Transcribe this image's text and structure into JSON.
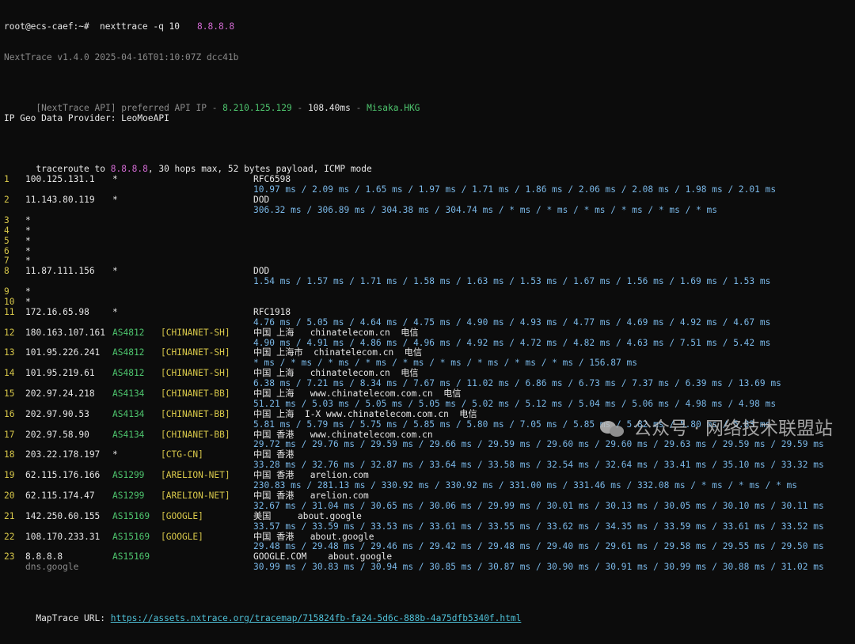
{
  "header": {
    "prompt": "root@ecs-caef:~#",
    "command": "nexttrace -q 10",
    "target": "8.8.8.8",
    "version_line": "NextTrace v1.4.0 2025-04-16T01:10:07Z dcc41b",
    "api_prefix": "[NextTrace API] preferred API IP - ",
    "api_ip": "8.210.125.129",
    "api_dash": " - ",
    "api_latency": "108.40ms",
    "api_dash2": " - ",
    "api_node": "Misaka.HKG",
    "geo_provider": "IP Geo Data Provider: LeoMoeAPI",
    "trace_prefix": "traceroute to ",
    "trace_target": "8.8.8.8",
    "trace_suffix": ", 30 hops max, 52 bytes payload, ICMP mode"
  },
  "hops": [
    {
      "n": "1",
      "ip": "100.125.131.1",
      "asn": "*",
      "tag": "",
      "geo": "RFC6598",
      "rtt": "10.97 ms / 2.09 ms / 1.65 ms / 1.97 ms / 1.71 ms / 1.86 ms / 2.06 ms / 2.08 ms / 1.98 ms / 2.01 ms"
    },
    {
      "n": "2",
      "ip": "11.143.80.119",
      "asn": "*",
      "tag": "",
      "geo": "DOD",
      "rtt": "306.32 ms / 306.89 ms / 304.38 ms / 304.74 ms / * ms / * ms / * ms / * ms / * ms / * ms"
    },
    {
      "n": "3",
      "ip": "*",
      "star": true
    },
    {
      "n": "4",
      "ip": "*",
      "star": true
    },
    {
      "n": "5",
      "ip": "*",
      "star": true
    },
    {
      "n": "6",
      "ip": "*",
      "star": true
    },
    {
      "n": "7",
      "ip": "*",
      "star": true
    },
    {
      "n": "8",
      "ip": "11.87.111.156",
      "asn": "*",
      "tag": "",
      "geo": "DOD",
      "rtt": "1.54 ms / 1.57 ms / 1.71 ms / 1.58 ms / 1.63 ms / 1.53 ms / 1.67 ms / 1.56 ms / 1.69 ms / 1.53 ms"
    },
    {
      "n": "9",
      "ip": "*",
      "star": true
    },
    {
      "n": "10",
      "ip": "*",
      "star": true
    },
    {
      "n": "11",
      "ip": "172.16.65.98",
      "asn": "*",
      "tag": "",
      "geo": "RFC1918",
      "rtt": "4.76 ms / 5.05 ms / 4.64 ms / 4.75 ms / 4.90 ms / 4.93 ms / 4.77 ms / 4.69 ms / 4.92 ms / 4.67 ms"
    },
    {
      "n": "12",
      "ip": "180.163.107.161",
      "asn": "AS4812",
      "tag": "[CHINANET-SH]",
      "geo": "中国 上海   chinatelecom.cn  电信",
      "rtt": "4.90 ms / 4.91 ms / 4.86 ms / 4.96 ms / 4.92 ms / 4.72 ms / 4.82 ms / 4.63 ms / 7.51 ms / 5.42 ms"
    },
    {
      "n": "13",
      "ip": "101.95.226.241",
      "asn": "AS4812",
      "tag": "[CHINANET-SH]",
      "geo": "中国 上海市  chinatelecom.cn  电信",
      "rtt": "* ms / * ms / * ms / * ms / * ms / * ms / * ms / * ms / * ms / 156.87 ms"
    },
    {
      "n": "14",
      "ip": "101.95.219.61",
      "asn": "AS4812",
      "tag": "[CHINANET-SH]",
      "geo": "中国 上海   chinatelecom.cn  电信",
      "rtt": "6.38 ms / 7.21 ms / 8.34 ms / 7.67 ms / 11.02 ms / 6.86 ms / 6.73 ms / 7.37 ms / 6.39 ms / 13.69 ms"
    },
    {
      "n": "15",
      "ip": "202.97.24.218",
      "asn": "AS4134",
      "tag": "[CHINANET-BB]",
      "geo": "中国 上海   www.chinatelecom.com.cn  电信",
      "rtt": "51.21 ms / 5.03 ms / 5.05 ms / 5.05 ms / 5.02 ms / 5.12 ms / 5.04 ms / 5.06 ms / 4.98 ms / 4.98 ms"
    },
    {
      "n": "16",
      "ip": "202.97.90.53",
      "asn": "AS4134",
      "tag": "[CHINANET-BB]",
      "geo": "中国 上海  I-X www.chinatelecom.com.cn  电信",
      "rtt": "5.81 ms / 5.79 ms / 5.75 ms / 5.85 ms / 5.80 ms / 7.05 ms / 5.85 ms / 5.82 ms / 5.80 ms / 5.83 ms"
    },
    {
      "n": "17",
      "ip": "202.97.58.90",
      "asn": "AS4134",
      "tag": "[CHINANET-BB]",
      "geo": "中国 香港   www.chinatelecom.com.cn",
      "rtt": "29.72 ms / 29.76 ms / 29.59 ms / 29.66 ms / 29.59 ms / 29.60 ms / 29.60 ms / 29.63 ms / 29.59 ms / 29.59 ms"
    },
    {
      "n": "18",
      "ip": "203.22.178.197",
      "asn": "*",
      "tag": "[CTG-CN]",
      "geo": "中国 香港",
      "rtt": "33.28 ms / 32.76 ms / 32.87 ms / 33.64 ms / 33.58 ms / 32.54 ms / 32.64 ms / 33.41 ms / 35.10 ms / 33.32 ms"
    },
    {
      "n": "19",
      "ip": "62.115.176.166",
      "asn": "AS1299",
      "tag": "[ARELION-NET]",
      "geo": "中国 香港   arelion.com",
      "rtt": "230.83 ms / 281.13 ms / 330.92 ms / 330.92 ms / 331.00 ms / 331.46 ms / 332.08 ms / * ms / * ms / * ms"
    },
    {
      "n": "20",
      "ip": "62.115.174.47",
      "asn": "AS1299",
      "tag": "[ARELION-NET]",
      "geo": "中国 香港   arelion.com",
      "rtt": "32.67 ms / 31.04 ms / 30.65 ms / 30.06 ms / 29.99 ms / 30.01 ms / 30.13 ms / 30.05 ms / 30.10 ms / 30.11 ms"
    },
    {
      "n": "21",
      "ip": "142.250.60.155",
      "asn": "AS15169",
      "tag": "[GOOGLE]",
      "geo": "美国     about.google",
      "rtt": "33.57 ms / 33.59 ms / 33.53 ms / 33.61 ms / 33.55 ms / 33.62 ms / 34.35 ms / 33.59 ms / 33.61 ms / 33.52 ms"
    },
    {
      "n": "22",
      "ip": "108.170.233.31",
      "asn": "AS15169",
      "tag": "[GOOGLE]",
      "geo": "中国 香港   about.google",
      "rtt": "29.48 ms / 29.48 ms / 29.46 ms / 29.42 ms / 29.48 ms / 29.40 ms / 29.61 ms / 29.58 ms / 29.55 ms / 29.50 ms"
    },
    {
      "n": "23",
      "ip": "8.8.8.8",
      "asn": "AS15169",
      "tag": "",
      "geo": "GOOGLE.COM    about.google",
      "rtt": "30.99 ms / 30.83 ms / 30.94 ms / 30.85 ms / 30.87 ms / 30.90 ms / 30.91 ms / 30.99 ms / 30.88 ms / 31.02 ms",
      "host": "dns.google"
    }
  ],
  "footer": {
    "label": "MapTrace URL: ",
    "url": "https://assets.nxtrace.org/tracemap/715824fb-fa24-5d6c-888b-4a75dfb5340f.html"
  },
  "watermark": {
    "text": "公众号 · 网络技术联盟站",
    "icon": "wechat-icon"
  }
}
